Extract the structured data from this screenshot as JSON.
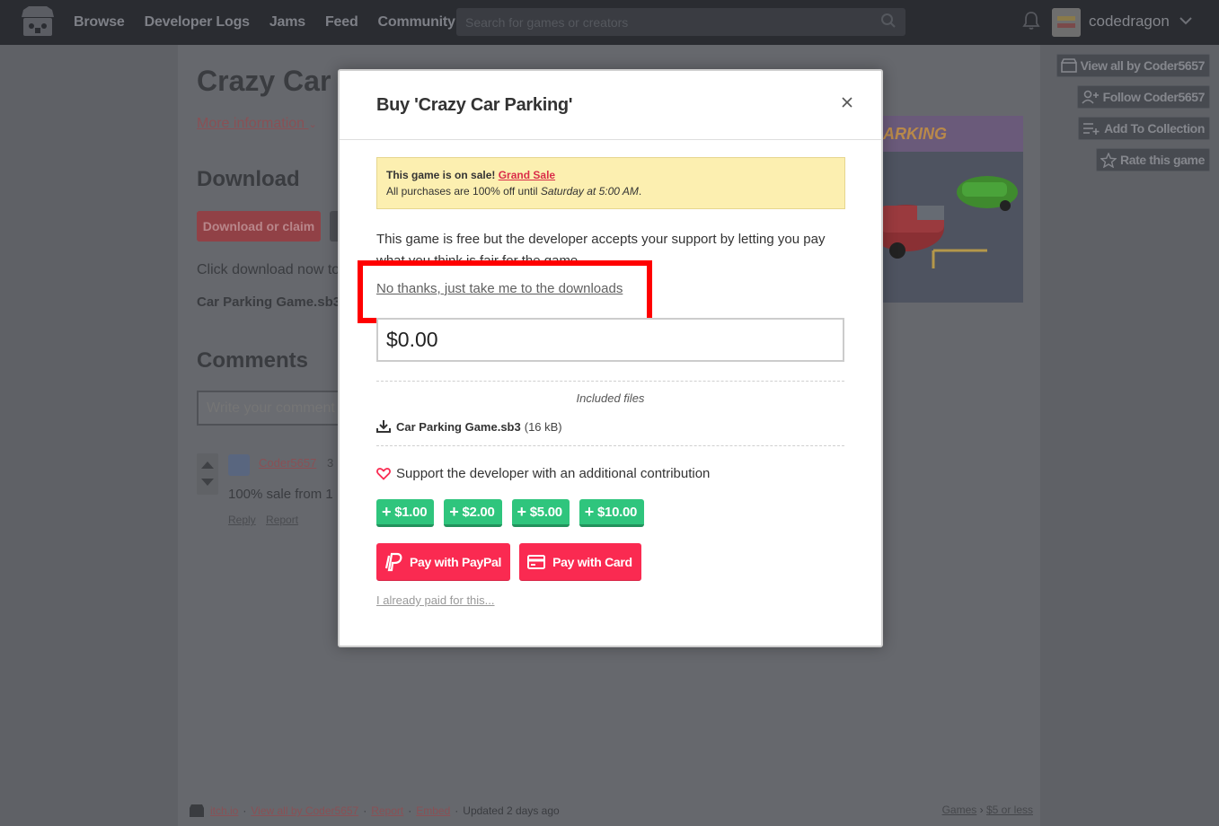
{
  "nav": {
    "links": [
      "Browse",
      "Developer Logs",
      "Jams",
      "Feed",
      "Community"
    ],
    "search_placeholder": "Search for games or creators",
    "username": "codedragon"
  },
  "side_actions": {
    "view_all": "View all by Coder5657",
    "follow": "Follow Coder5657",
    "add_collection": "Add To Collection",
    "rate": "Rate this game"
  },
  "background": {
    "title": "Crazy Car P",
    "more_info": "More information",
    "download_heading": "Download",
    "download_button": "Download or claim",
    "click_text": "Click download now to",
    "file": "Car Parking Game.sb3",
    "comments_heading": "Comments",
    "comment_placeholder": "Write your comment",
    "comment_author": "Coder5657",
    "comment_time": "3",
    "comment_text": "100% sale from 1",
    "comment_reply": "Reply",
    "comment_report": "Report",
    "screenshot_text": "ARKING"
  },
  "modal": {
    "title": "Buy 'Crazy Car Parking'",
    "sale_prefix": "This game is on sale!",
    "sale_link": "Grand Sale",
    "sale_line2_prefix": "All purchases are 100% off until",
    "sale_line2_time": "Saturday at 5:00 AM",
    "sale_line2_suffix": ".",
    "free_text": "This game is free but the developer accepts your support by letting you pay what you think is fair for the game.",
    "no_thanks": "No thanks, just take me to the downloads",
    "price_value": "$0.00",
    "included_files_label": "Included files",
    "file_name": "Car Parking Game.sb3",
    "file_size": "(16 kB)",
    "support_text": "Support the developer with an additional contribution",
    "tips": [
      "$1.00",
      "$2.00",
      "$5.00",
      "$10.00"
    ],
    "pay_paypal": "Pay with PayPal",
    "pay_card": "Pay with Card",
    "already_paid": "I already paid for this..."
  },
  "footer": {
    "itch": "itch.io",
    "view_all": "View all by Coder5657",
    "report": "Report",
    "embed": "Embed",
    "updated": "Updated 2 days ago",
    "games": "Games",
    "price_filter": "$5 or less"
  },
  "colors": {
    "accent": "#fa2a51",
    "tip_green": "#2fc57d",
    "sale_bg": "#fcefb0",
    "highlight": "#ff0000"
  }
}
